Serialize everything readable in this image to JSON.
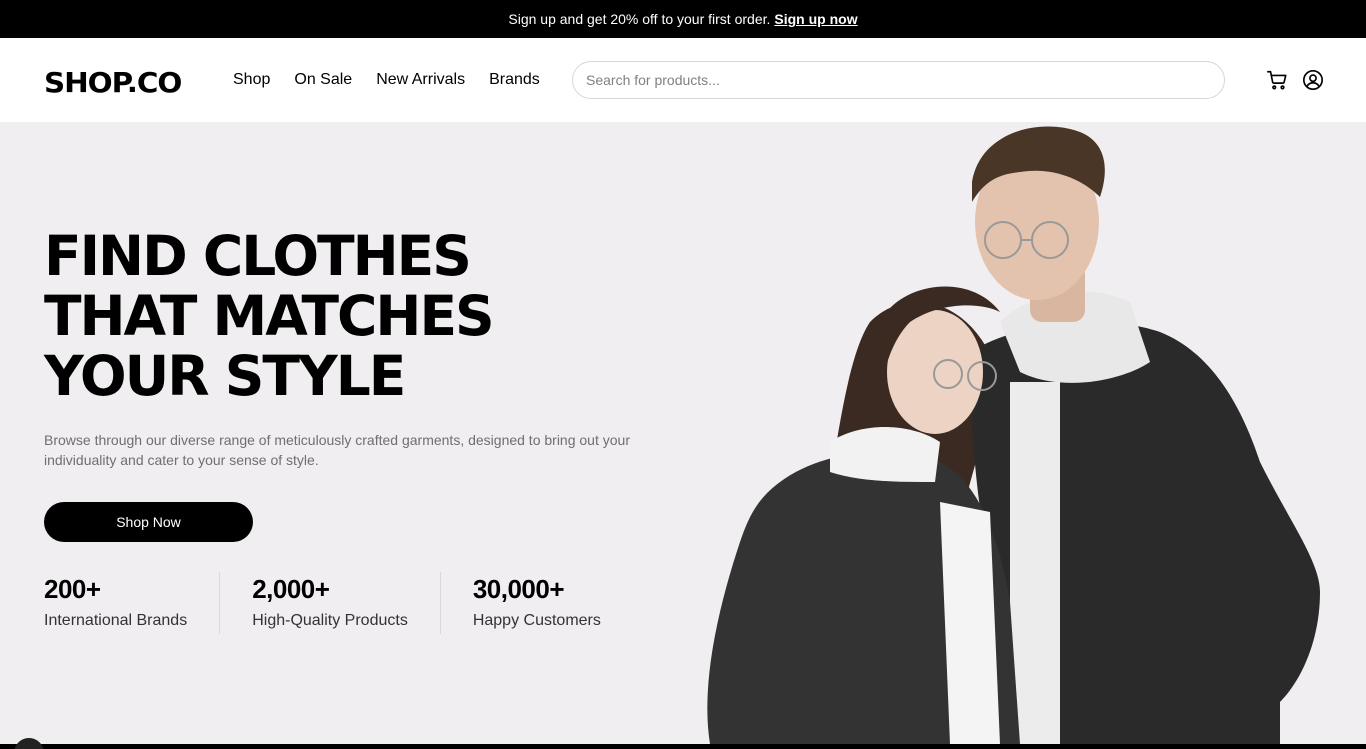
{
  "topbar": {
    "text": "Sign up and get 20% off to your first order.",
    "link": "Sign up now"
  },
  "nav": {
    "logo": "SHOP.CO",
    "menu": [
      "Shop",
      "On Sale",
      "New Arrivals",
      "Brands"
    ],
    "search_placeholder": "Search for products...",
    "icons": [
      "cart-icon",
      "account-icon"
    ]
  },
  "hero": {
    "title_lines": [
      "FIND CLOTHES",
      "THAT MATCHES",
      "YOUR STYLE"
    ],
    "description": "Browse through our diverse range of meticulously crafted garments, designed to bring out your individuality and cater to your sense of style.",
    "button": "Shop Now",
    "stats": [
      {
        "value": "200+",
        "label": "International Brands"
      },
      {
        "value": "2,000+",
        "label": "High-Quality Products"
      },
      {
        "value": "30,000+",
        "label": "Happy Customers"
      }
    ],
    "image": "fashion-couple-photo"
  },
  "colors": {
    "accent": "#000000",
    "hero_bg": "#f0eef0",
    "muted_text": "#6f6f6f"
  }
}
